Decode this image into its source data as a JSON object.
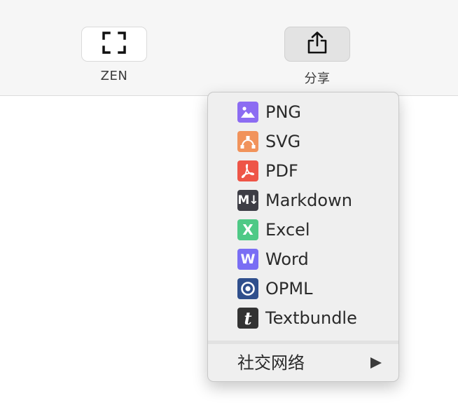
{
  "toolbar": {
    "zen": {
      "label": "ZEN",
      "icon": "fullscreen-icon"
    },
    "share": {
      "label": "分享",
      "icon": "share-icon"
    }
  },
  "export_menu": {
    "items": [
      {
        "label": "PNG",
        "icon": "image-icon",
        "color": "#8c6cf2"
      },
      {
        "label": "SVG",
        "icon": "vector-path-icon",
        "color": "#f1935b"
      },
      {
        "label": "PDF",
        "icon": "pdf-icon",
        "color": "#ee5547"
      },
      {
        "label": "Markdown",
        "icon": "markdown-icon",
        "color": "#3d3d45",
        "glyph": "M↓"
      },
      {
        "label": "Excel",
        "icon": "excel-icon",
        "color": "#4fc986",
        "glyph": "X"
      },
      {
        "label": "Word",
        "icon": "word-icon",
        "color": "#7a6ef4",
        "glyph": "W"
      },
      {
        "label": "OPML",
        "icon": "opml-icon",
        "color": "#2f4f8c"
      },
      {
        "label": "Textbundle",
        "icon": "textbundle-icon",
        "color": "#333333",
        "glyph": "t"
      }
    ],
    "submenu": {
      "label": "社交网络",
      "icon": "submenu-arrow-icon"
    }
  }
}
